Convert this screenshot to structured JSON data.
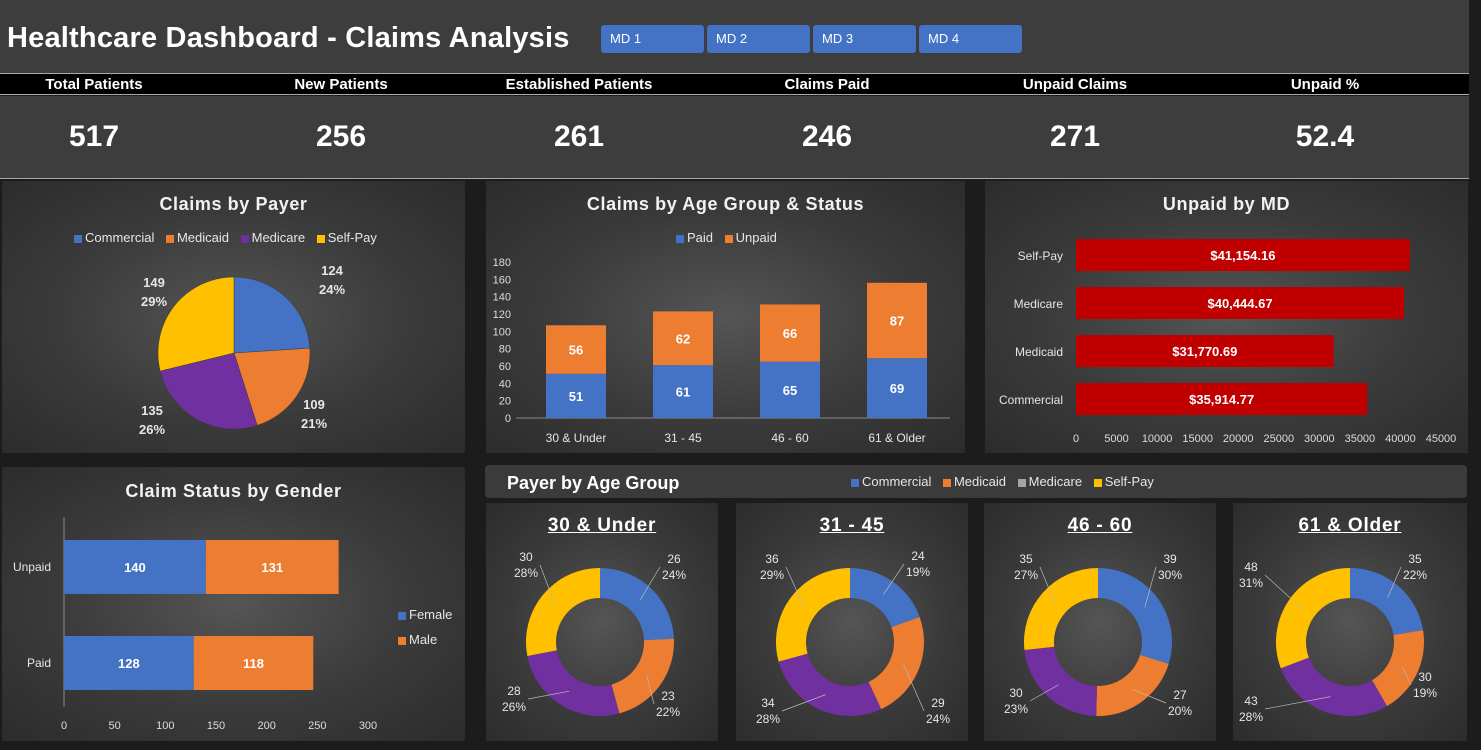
{
  "header": {
    "title": "Healthcare Dashboard - Claims Analysis",
    "md_buttons": [
      "MD 1",
      "MD 2",
      "MD 3",
      "MD 4"
    ]
  },
  "kpis": [
    {
      "label": "Total Patients",
      "value": "517"
    },
    {
      "label": "New Patients",
      "value": "256"
    },
    {
      "label": "Established Patients",
      "value": "261"
    },
    {
      "label": "Claims Paid",
      "value": "246"
    },
    {
      "label": "Unpaid Claims",
      "value": "271"
    },
    {
      "label": "Unpaid %",
      "value": "52.4"
    }
  ],
  "colors": {
    "commercial": "#4472c4",
    "medicaid": "#ed7d31",
    "medicare": "#7030a0",
    "selfpay": "#ffc000",
    "medicare_legend": "#a5a5a5",
    "unpaid_bar": "#c00000"
  },
  "payer_pie": {
    "title": "Claims by Payer",
    "legend": [
      "Commercial",
      "Medicaid",
      "Medicare",
      "Self-Pay"
    ],
    "chart_data": {
      "type": "pie",
      "categories": [
        "Commercial",
        "Medicaid",
        "Medicare",
        "Self-Pay"
      ],
      "values": [
        124,
        109,
        135,
        149
      ],
      "percents": [
        "24%",
        "21%",
        "26%",
        "29%"
      ]
    }
  },
  "age_status": {
    "title": "Claims by Age Group & Status",
    "legend": [
      "Paid",
      "Unpaid"
    ],
    "chart_data": {
      "type": "bar",
      "stacked": true,
      "categories": [
        "30 & Under",
        "31 - 45",
        "46 - 60",
        "61 & Older"
      ],
      "series": [
        {
          "name": "Paid",
          "values": [
            51,
            61,
            65,
            69
          ]
        },
        {
          "name": "Unpaid",
          "values": [
            56,
            62,
            66,
            87
          ]
        }
      ],
      "ylim": [
        0,
        180
      ],
      "yticks": [
        "0",
        "20",
        "40",
        "60",
        "80",
        "100",
        "120",
        "140",
        "160",
        "180"
      ]
    }
  },
  "unpaid_md": {
    "title": "Unpaid by MD",
    "chart_data": {
      "type": "bar",
      "orientation": "horizontal",
      "categories": [
        "Self-Pay",
        "Medicare",
        "Medicaid",
        "Commercial"
      ],
      "values": [
        41154.16,
        40444.67,
        31770.69,
        35914.77
      ],
      "labels": [
        "$41,154.16",
        "$40,444.67",
        "$31,770.69",
        "$35,914.77"
      ],
      "xlim": [
        0,
        45000
      ],
      "xticks": [
        "0",
        "5000",
        "10000",
        "15000",
        "20000",
        "25000",
        "30000",
        "35000",
        "40000",
        "45000"
      ]
    }
  },
  "gender": {
    "title": "Claim Status by Gender",
    "legend": [
      "Female",
      "Male"
    ],
    "chart_data": {
      "type": "bar",
      "orientation": "horizontal",
      "stacked": true,
      "categories": [
        "Unpaid",
        "Paid"
      ],
      "series": [
        {
          "name": "Female",
          "values": [
            140,
            128
          ]
        },
        {
          "name": "Male",
          "values": [
            131,
            118
          ]
        }
      ],
      "xlim": [
        0,
        300
      ],
      "xticks": [
        "0",
        "50",
        "100",
        "150",
        "200",
        "250",
        "300"
      ]
    }
  },
  "payer_age": {
    "title": "Payer by Age Group",
    "legend": [
      "Commercial",
      "Medicaid",
      "Medicare",
      "Self-Pay"
    ],
    "chart_data": [
      {
        "type": "pie",
        "donut": true,
        "title": "30 & Under",
        "categories": [
          "Commercial",
          "Medicaid",
          "Medicare",
          "Self-Pay"
        ],
        "values": [
          26,
          23,
          28,
          30
        ],
        "percents": [
          "24%",
          "22%",
          "26%",
          "28%"
        ]
      },
      {
        "type": "pie",
        "donut": true,
        "title": "31 - 45",
        "categories": [
          "Commercial",
          "Medicaid",
          "Medicare",
          "Self-Pay"
        ],
        "values": [
          24,
          29,
          34,
          36
        ],
        "percents": [
          "19%",
          "24%",
          "28%",
          "29%"
        ]
      },
      {
        "type": "pie",
        "donut": true,
        "title": "46 - 60",
        "categories": [
          "Commercial",
          "Medicaid",
          "Medicare",
          "Self-Pay"
        ],
        "values": [
          39,
          27,
          30,
          35
        ],
        "percents": [
          "30%",
          "20%",
          "23%",
          "27%"
        ]
      },
      {
        "type": "pie",
        "donut": true,
        "title": "61 & Older",
        "categories": [
          "Commercial",
          "Medicaid",
          "Medicare",
          "Self-Pay"
        ],
        "values": [
          35,
          30,
          43,
          48
        ],
        "percents": [
          "22%",
          "19%",
          "28%",
          "31%"
        ]
      }
    ]
  }
}
